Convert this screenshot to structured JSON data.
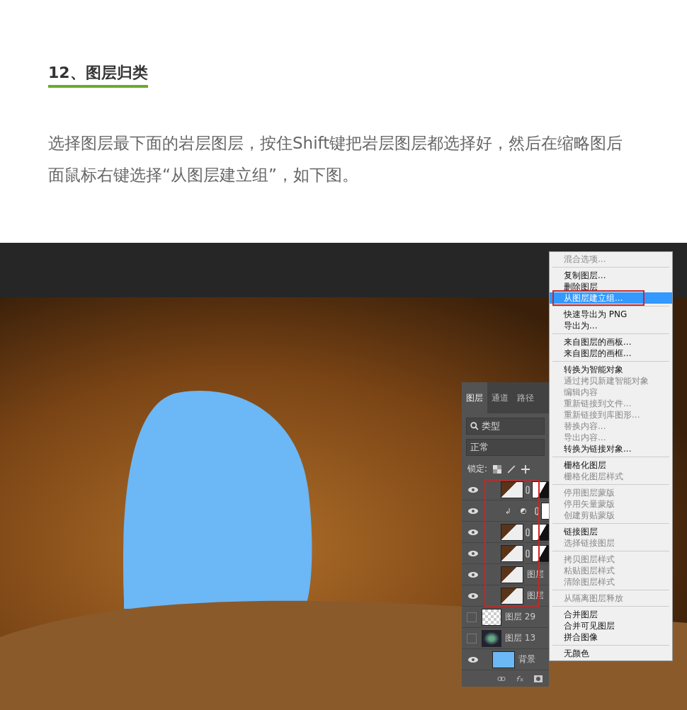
{
  "heading": "12、图层归类",
  "paragraph": "选择图层最下面的岩层图层，按住Shift键把岩层图层都选择好，然后在缩略图后面鼠标右键选择“从图层建立组”，如下图。",
  "layers_panel": {
    "tabs": [
      {
        "label": "图层",
        "selected": true
      },
      {
        "label": "通道",
        "selected": false
      },
      {
        "label": "路径",
        "selected": false
      }
    ],
    "filter": "类型",
    "blend_mode": "正常",
    "lock_label": "锁定:",
    "layers": [
      {
        "kind": "masked",
        "visible": true,
        "highlighted": true
      },
      {
        "kind": "adjustment",
        "visible": true,
        "highlighted": true
      },
      {
        "kind": "masked",
        "visible": true,
        "highlighted": true
      },
      {
        "kind": "masked",
        "visible": true,
        "highlighted": true
      },
      {
        "kind": "plain",
        "name": "图层",
        "visible": true,
        "highlighted": true
      },
      {
        "kind": "plain",
        "name": "图层",
        "visible": true,
        "highlighted": true
      },
      {
        "kind": "transparent",
        "name": "图层 29",
        "visible": false,
        "highlighted": false
      },
      {
        "kind": "photo",
        "name": "图层 13",
        "visible": false,
        "highlighted": false
      },
      {
        "kind": "fill",
        "name": "背景",
        "visible": true,
        "highlighted": false
      }
    ]
  },
  "context_menu": [
    [
      {
        "label": "混合选项...",
        "disabled": true,
        "selected": false,
        "highlighted": false
      }
    ],
    [
      {
        "label": "复制图层...",
        "disabled": false,
        "selected": false,
        "highlighted": false
      },
      {
        "label": "删除图层",
        "disabled": false,
        "selected": false,
        "highlighted": false
      },
      {
        "label": "从图层建立组...",
        "disabled": false,
        "selected": true,
        "highlighted": true
      }
    ],
    [
      {
        "label": "快速导出为 PNG",
        "disabled": false,
        "selected": false,
        "highlighted": false
      },
      {
        "label": "导出为...",
        "disabled": false,
        "selected": false,
        "highlighted": false
      }
    ],
    [
      {
        "label": "来自图层的画板...",
        "disabled": false,
        "selected": false,
        "highlighted": false
      },
      {
        "label": "来自图层的画框...",
        "disabled": false,
        "selected": false,
        "highlighted": false
      }
    ],
    [
      {
        "label": "转换为智能对象",
        "disabled": false,
        "selected": false,
        "highlighted": false
      },
      {
        "label": "通过拷贝新建智能对象",
        "disabled": true,
        "selected": false,
        "highlighted": false
      },
      {
        "label": "编辑内容",
        "disabled": true,
        "selected": false,
        "highlighted": false
      },
      {
        "label": "重新链接到文件...",
        "disabled": true,
        "selected": false,
        "highlighted": false
      },
      {
        "label": "重新链接到库图形...",
        "disabled": true,
        "selected": false,
        "highlighted": false
      },
      {
        "label": "替换内容...",
        "disabled": true,
        "selected": false,
        "highlighted": false
      },
      {
        "label": "导出内容...",
        "disabled": true,
        "selected": false,
        "highlighted": false
      },
      {
        "label": "转换为链接对象...",
        "disabled": false,
        "selected": false,
        "highlighted": false
      }
    ],
    [
      {
        "label": "栅格化图层",
        "disabled": false,
        "selected": false,
        "highlighted": false
      },
      {
        "label": "栅格化图层样式",
        "disabled": true,
        "selected": false,
        "highlighted": false
      }
    ],
    [
      {
        "label": "停用图层蒙版",
        "disabled": true,
        "selected": false,
        "highlighted": false
      },
      {
        "label": "停用矢量蒙版",
        "disabled": true,
        "selected": false,
        "highlighted": false
      },
      {
        "label": "创建剪贴蒙版",
        "disabled": true,
        "selected": false,
        "highlighted": false
      }
    ],
    [
      {
        "label": "链接图层",
        "disabled": false,
        "selected": false,
        "highlighted": false
      },
      {
        "label": "选择链接图层",
        "disabled": true,
        "selected": false,
        "highlighted": false
      }
    ],
    [
      {
        "label": "拷贝图层样式",
        "disabled": true,
        "selected": false,
        "highlighted": false
      },
      {
        "label": "粘贴图层样式",
        "disabled": true,
        "selected": false,
        "highlighted": false
      },
      {
        "label": "清除图层样式",
        "disabled": true,
        "selected": false,
        "highlighted": false
      }
    ],
    [
      {
        "label": "从隔离图层释放",
        "disabled": true,
        "selected": false,
        "highlighted": false
      }
    ],
    [
      {
        "label": "合并图层",
        "disabled": false,
        "selected": false,
        "highlighted": false
      },
      {
        "label": "合并可见图层",
        "disabled": false,
        "selected": false,
        "highlighted": false
      },
      {
        "label": "拼合图像",
        "disabled": false,
        "selected": false,
        "highlighted": false
      }
    ],
    [
      {
        "label": "无颜色",
        "disabled": false,
        "selected": false,
        "highlighted": false
      }
    ]
  ]
}
